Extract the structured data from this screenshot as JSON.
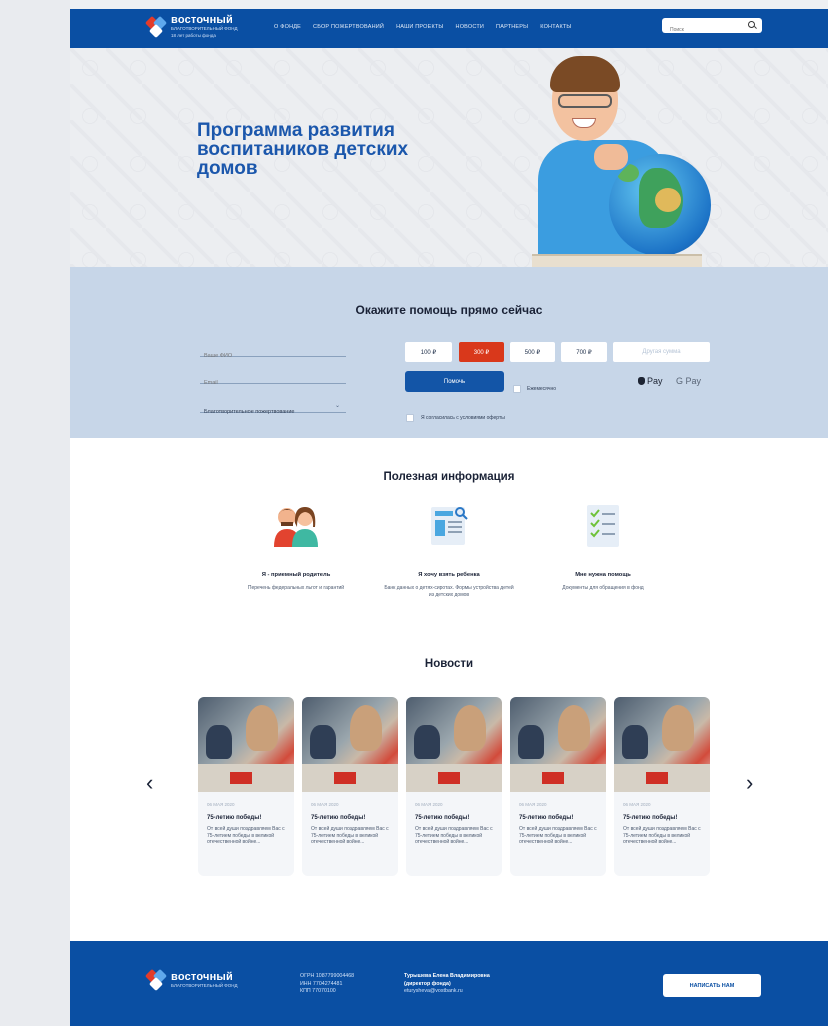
{
  "header": {
    "logo_name": "восточный",
    "logo_sub": "благотворительный фонд",
    "logo_years": "18 лет работы фонда",
    "nav": [
      "О ФОНДЕ",
      "СБОР ПОЖЕРТВОВАНИЙ",
      "НАШИ ПРОЕКТЫ",
      "НОВОСТИ",
      "ПАРТНЕРЫ",
      "КОНТАКТЫ"
    ],
    "search_placeholder": "Поиск",
    "search_icon": "magnifier-icon"
  },
  "hero": {
    "title": "Программа развития воспитаников детских домов"
  },
  "donate": {
    "title": "Окажите помощь прямо сейчас",
    "name_placeholder": "Ваше ФИО",
    "email_placeholder": "Email",
    "type_value": "Благотворительное пожертвование",
    "amounts": [
      "100 ₽",
      "300 ₽",
      "500 ₽",
      "700 ₽"
    ],
    "selected_amount": "300 ₽",
    "other_placeholder": "Другая сумма",
    "help_button": "Помочь",
    "monthly_label": "Ежемесячно",
    "agree_label": "Я согласилась с условиями оферты",
    "apple_pay": "Pay",
    "google_pay": "G Pay",
    "accent_color": "#d9381b"
  },
  "info": {
    "title": "Полезная информация",
    "cards": [
      {
        "icon": "parents-icon",
        "title": "Я - приемный родитель",
        "text": "Перечень федеральных льгот и гарантий"
      },
      {
        "icon": "database-search-icon",
        "title": "Я хочу взять ребенка",
        "text": "Банк данных о детях-сиротах. Формы устройства детей из детских домов"
      },
      {
        "icon": "checklist-icon",
        "title": "Мне нужна помощь",
        "text": "Документы для обращения в фонд"
      }
    ]
  },
  "news": {
    "title": "Новости",
    "items": [
      {
        "date": "06 МАЯ 2020",
        "title": "75-летию победы!",
        "text": "От всей души поздравляем Вас с 75-летием победы в великой отечественной войне..."
      },
      {
        "date": "06 МАЯ 2020",
        "title": "75-летию победы!",
        "text": "От всей души поздравляем Вас с 75-летием победы в великой отечественной войне..."
      },
      {
        "date": "06 МАЯ 2020",
        "title": "75-летию победы!",
        "text": "От всей души поздравляем Вас с 75-летием победы в великой отечественной войне..."
      },
      {
        "date": "06 МАЯ 2020",
        "title": "75-летию победы!",
        "text": "От всей души поздравляем Вас с 75-летием победы в великой отечественной войне..."
      },
      {
        "date": "06 МАЯ 2020",
        "title": "75-летию победы!",
        "text": "От всей души поздравляем Вас с 75-летием победы в великой отечественной войне..."
      }
    ],
    "prev": "‹",
    "next": "›"
  },
  "footer": {
    "ogrn": "ОГРН 1087799004468",
    "inn": "ИНН 7704274481",
    "kpp": "КПП 77070100",
    "director_name": "Турышева Елена Владимировна",
    "director_role": "(директор фонда)",
    "email": "eturysheva@vostbank.ru",
    "write_button": "Написать нам",
    "brand_color": "#0a4fa3"
  }
}
